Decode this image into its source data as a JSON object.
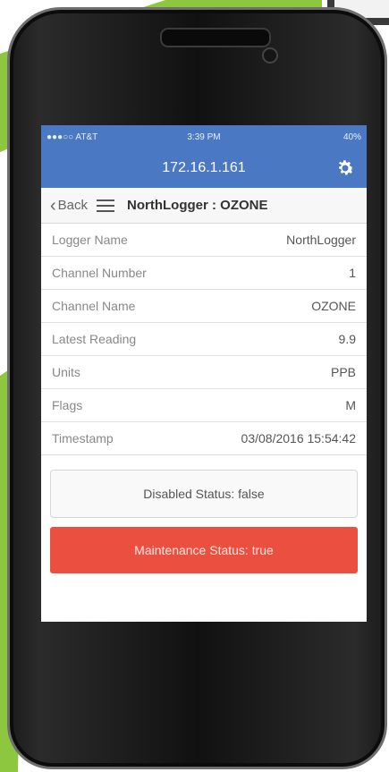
{
  "status_bar": {
    "carrier": "●●●○○ AT&T",
    "time": "3:39 PM",
    "battery": "40%"
  },
  "header": {
    "title": "172.16.1.161"
  },
  "nav": {
    "back_label": "Back",
    "title": "NorthLogger : OZONE"
  },
  "rows": [
    {
      "label": "Logger Name",
      "value": "NorthLogger"
    },
    {
      "label": "Channel Number",
      "value": "1"
    },
    {
      "label": "Channel Name",
      "value": "OZONE"
    },
    {
      "label": "Latest Reading",
      "value": "9.9"
    },
    {
      "label": "Units",
      "value": "PPB"
    },
    {
      "label": "Flags",
      "value": "M"
    },
    {
      "label": "Timestamp",
      "value": "03/08/2016 15:54:42"
    }
  ],
  "disabled_status": "Disabled Status: false",
  "maintenance_status": "Maintenance Status: true",
  "colors": {
    "header_blue": "#4a78c2",
    "alert_red": "#ea4f3f",
    "bg_green": "#8dc63f"
  },
  "icons": [
    "settings-gear-icon",
    "back-chevron-icon",
    "hamburger-menu-icon"
  ]
}
